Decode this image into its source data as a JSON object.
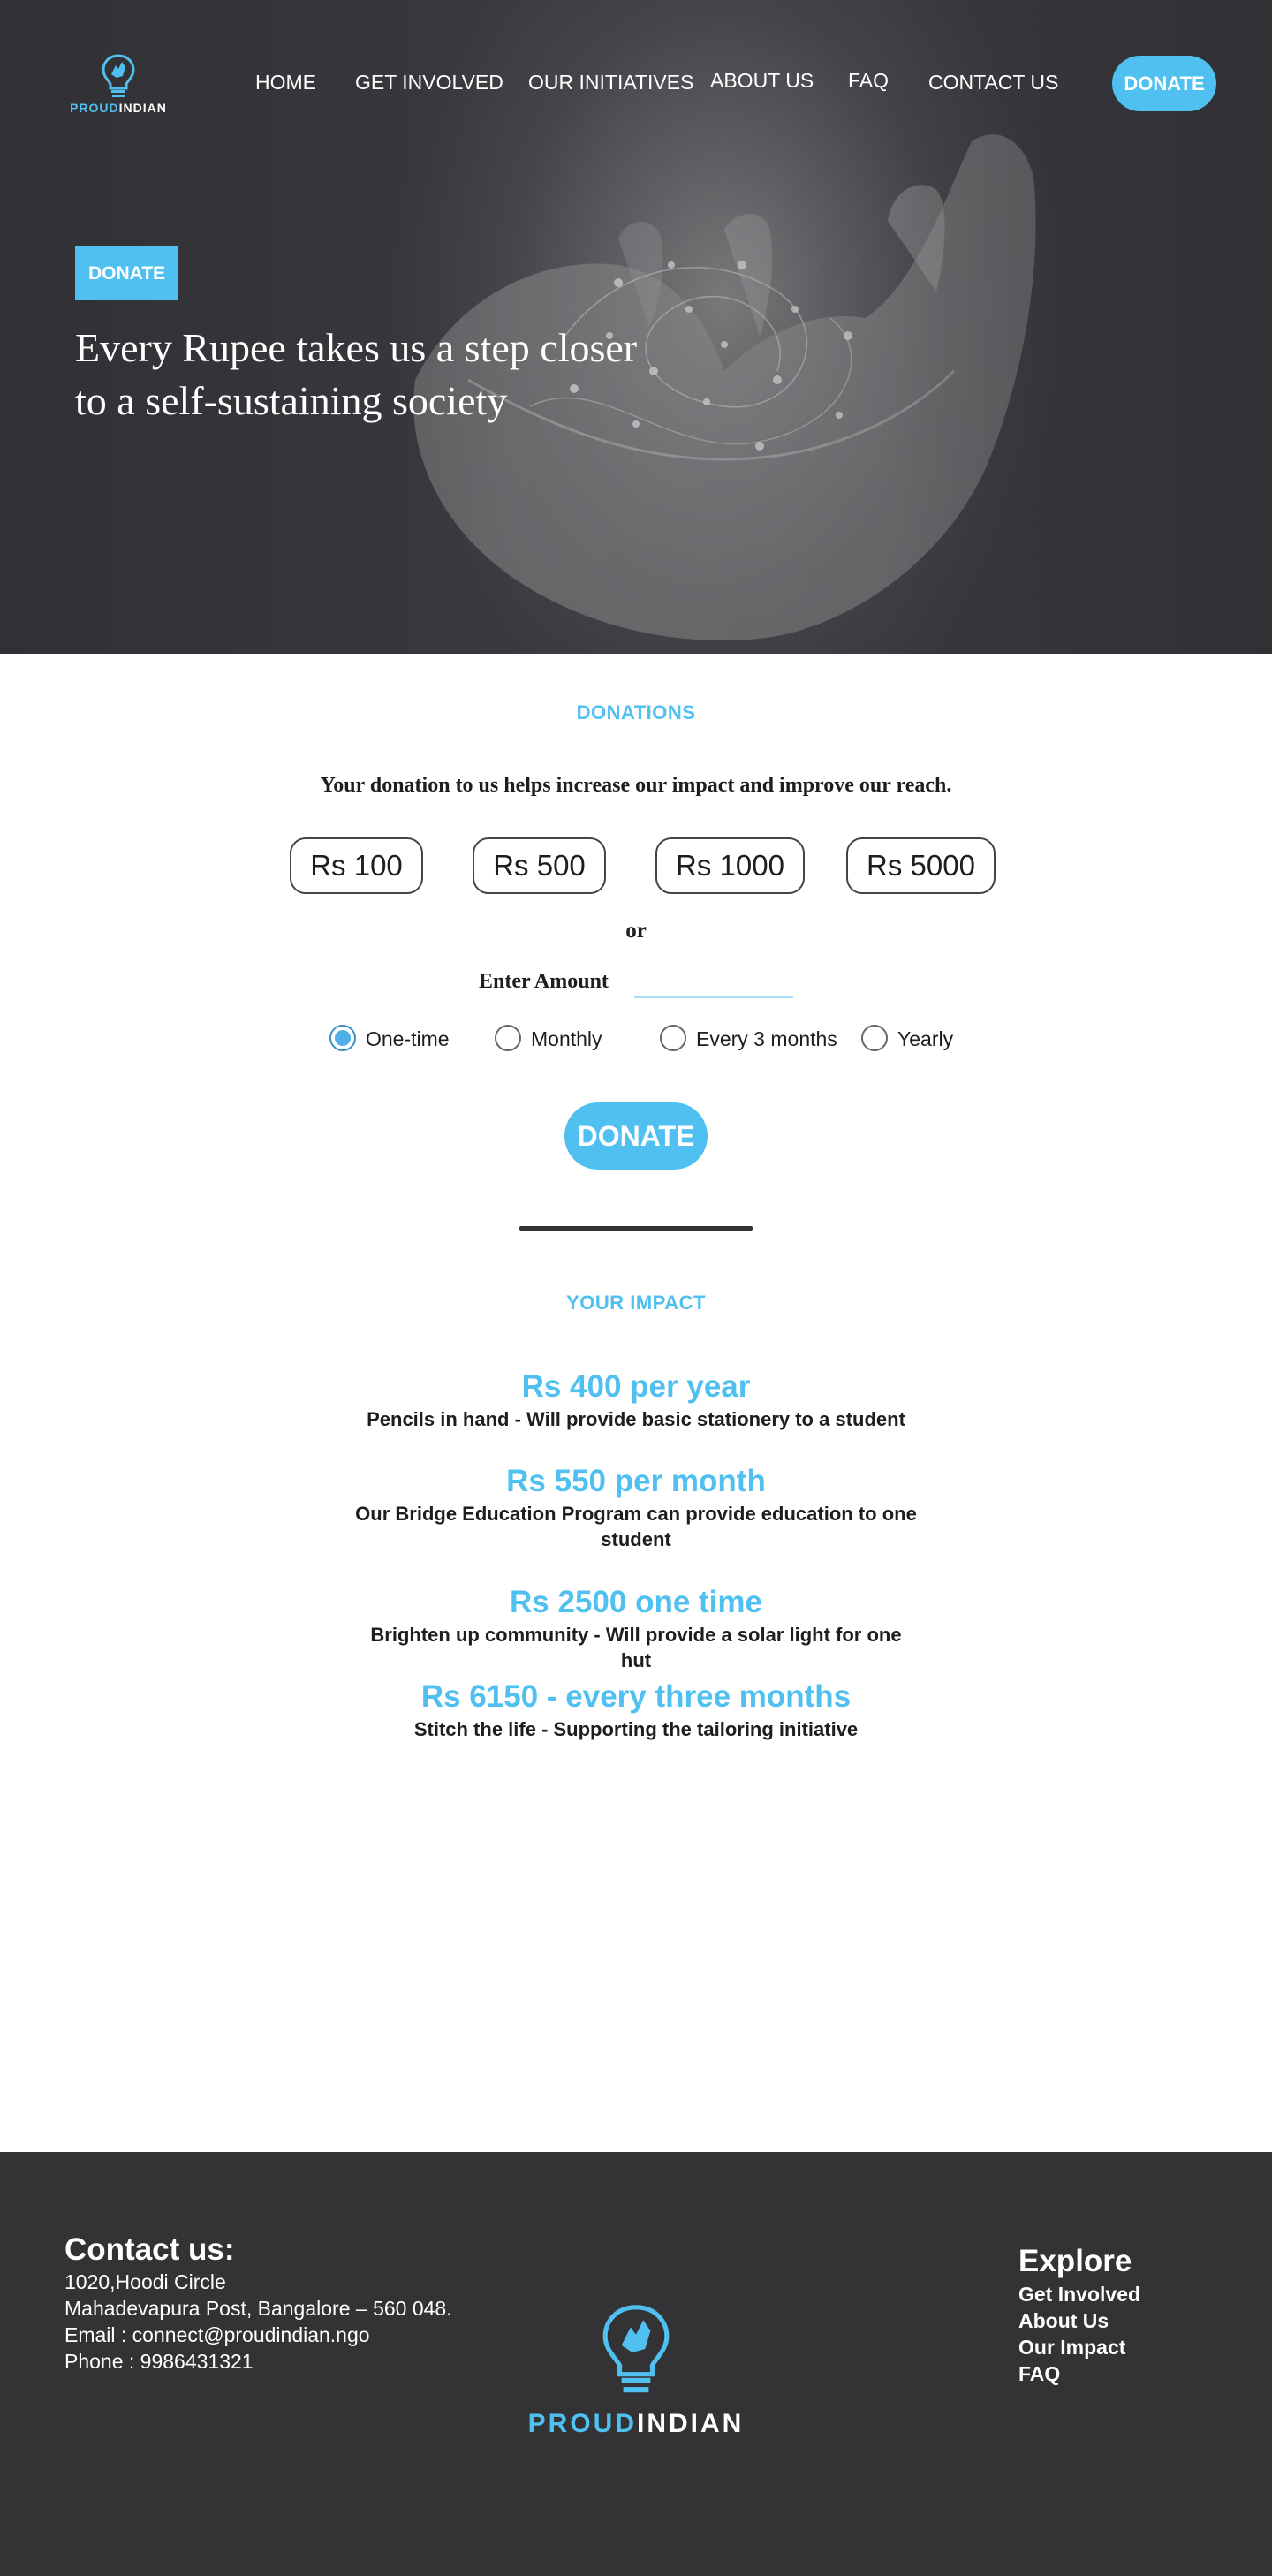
{
  "brand": {
    "logo_part1": "PROUD",
    "logo_part2": "INDIAN",
    "accent_color": "#4fc0f0",
    "dark_color": "#333336"
  },
  "nav": {
    "items": [
      "HOME",
      "GET INVOLVED",
      "OUR INITIATIVES",
      "ABOUT US",
      "FAQ",
      "CONTACT US"
    ],
    "donate_label": "DONATE"
  },
  "hero": {
    "badge": "DONATE",
    "title": "Every Rupee takes us a step closer to a self-sustaining society"
  },
  "donations": {
    "section_label": "DONATIONS",
    "intro": "Your donation to us helps increase our impact and improve our reach.",
    "amounts": [
      "Rs 100",
      "Rs 500",
      "Rs 1000",
      "Rs 5000"
    ],
    "or_text": "or",
    "enter_amount_label": "Enter Amount",
    "enter_amount_value": "",
    "frequency_options": [
      "One-time",
      "Monthly",
      "Every 3 months",
      "Yearly"
    ],
    "selected_frequency": "One-time",
    "donate_label": "DONATE"
  },
  "impact": {
    "section_label": "YOUR IMPACT",
    "items": [
      {
        "amount": "Rs 400 per year",
        "description": "Pencils in hand - Will provide basic stationery to a student"
      },
      {
        "amount": "Rs 550 per month",
        "description": "Our Bridge Education Program can provide education to one student"
      },
      {
        "amount": "Rs 2500 one time",
        "description": "Brighten up community - Will provide a solar light for one hut"
      },
      {
        "amount": "Rs 6150 - every three months",
        "description": "Stitch the life - Supporting the tailoring initiative"
      }
    ]
  },
  "footer": {
    "contact_heading": "Contact us:",
    "address_line1": "1020,Hoodi Circle",
    "address_line2": "Mahadevapura Post, Bangalore – 560 048.",
    "email": "Email : connect@proudindian.ngo",
    "phone": "Phone : 9986431321",
    "explore_heading": "Explore",
    "explore_links": [
      "Get Involved",
      "About Us",
      "Our Impact",
      "FAQ"
    ]
  }
}
